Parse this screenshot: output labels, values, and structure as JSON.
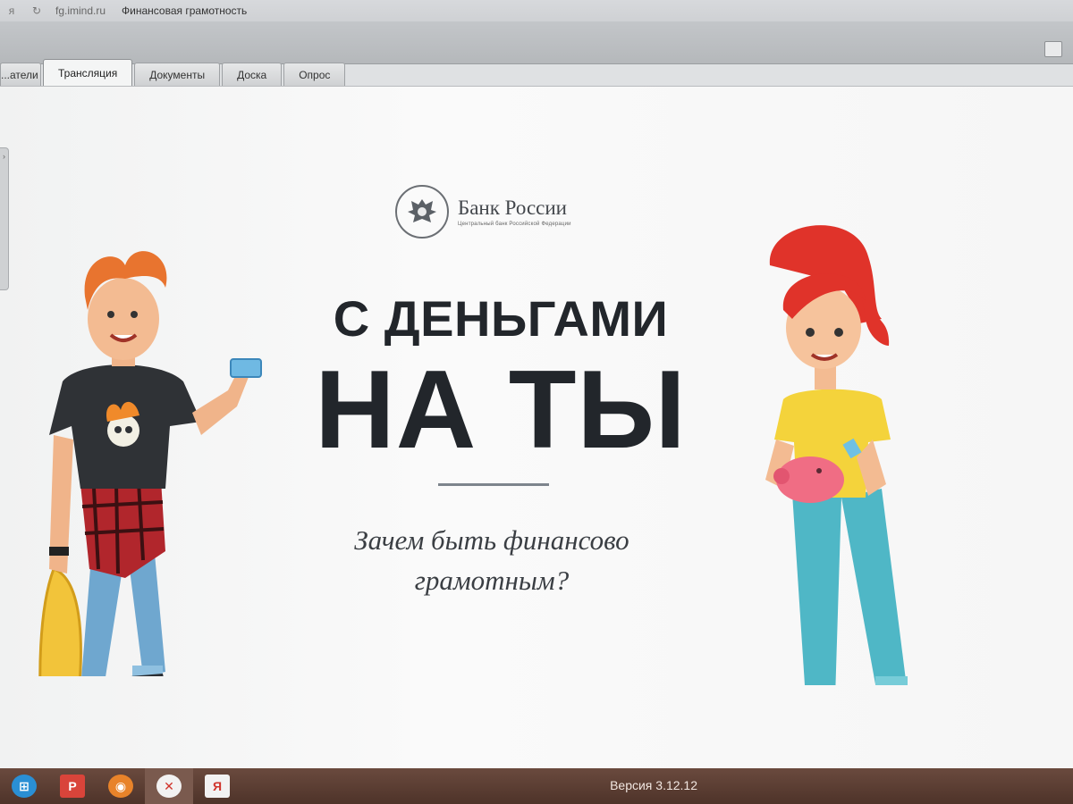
{
  "browser": {
    "url": "fg.imind.ru",
    "page_title": "Финансовая грамотность"
  },
  "tabs": [
    {
      "label": "...атели",
      "active": false
    },
    {
      "label": "Трансляция",
      "active": true
    },
    {
      "label": "Документы",
      "active": false
    },
    {
      "label": "Доска",
      "active": false
    },
    {
      "label": "Опрос",
      "active": false
    }
  ],
  "slide": {
    "bank_name": "Банк России",
    "bank_subtitle": "Центральный банк Российской Федерации",
    "headline_line1": "С ДЕНЬГАМИ",
    "headline_line2": "НА ТЫ",
    "subtitle_line1": "Зачем быть финансово",
    "subtitle_line2": "грамотным?"
  },
  "taskbar": {
    "version": "Версия 3.12.12",
    "icons": [
      "start-orb-icon",
      "presentation-app-icon",
      "firefox-icon",
      "yandex-browser-icon",
      "yandex-icon"
    ]
  },
  "colors": {
    "headline": "#22262b",
    "taskbar": "#5a3c31",
    "girl_hair": "#e0332a",
    "girl_shirt": "#f4d33b",
    "jeans": "#4fb7c6"
  }
}
